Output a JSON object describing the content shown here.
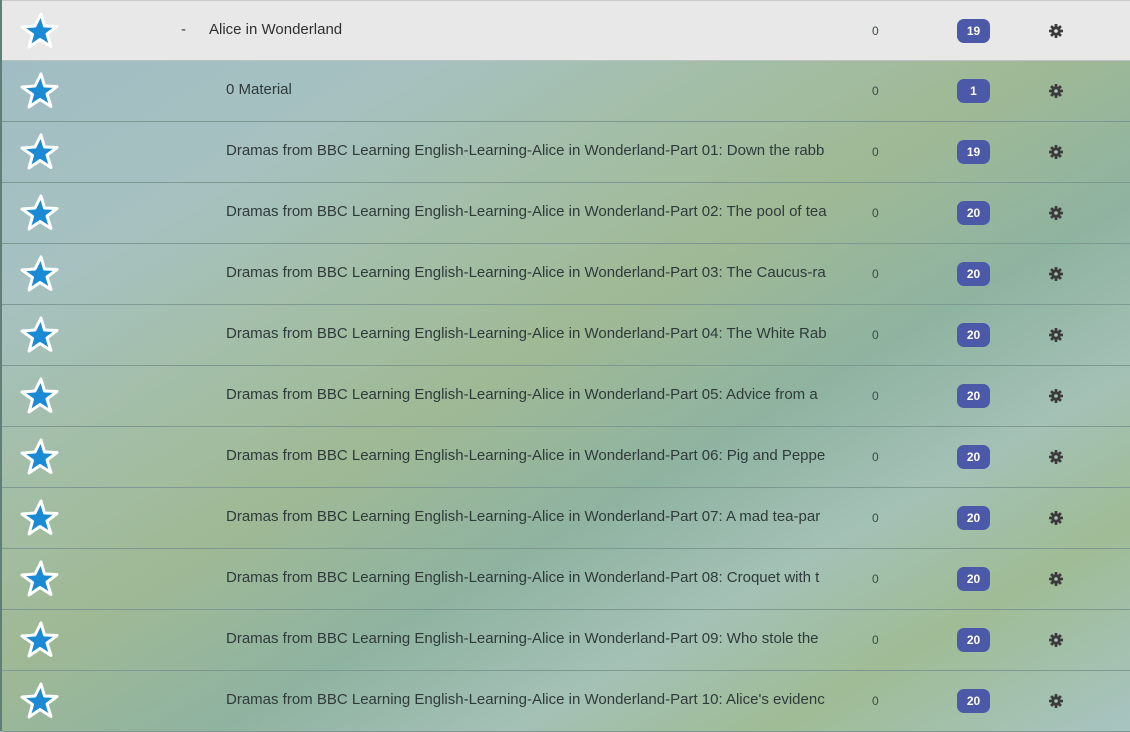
{
  "header": {
    "toggle": "-",
    "title": "Alice in Wonderland",
    "count": "0",
    "badge": "19",
    "star_icon": "star-icon",
    "settings_icon": "gear-icon"
  },
  "rows": [
    {
      "title": "0 Material",
      "count": "0",
      "badge": "1"
    },
    {
      "title": "Dramas from BBC Learning English-Learning-Alice in Wonderland-Part 01: Down the rabb",
      "count": "0",
      "badge": "19"
    },
    {
      "title": "Dramas from BBC Learning English-Learning-Alice in Wonderland-Part 02: The pool of tea",
      "count": "0",
      "badge": "20"
    },
    {
      "title": "Dramas from BBC Learning English-Learning-Alice in Wonderland-Part 03: The Caucus-ra",
      "count": "0",
      "badge": "20"
    },
    {
      "title": "Dramas from BBC Learning English-Learning-Alice in Wonderland-Part 04: The White Rab",
      "count": "0",
      "badge": "20"
    },
    {
      "title": "Dramas from BBC Learning English-Learning-Alice in Wonderland-Part 05: Advice from a",
      "count": "0",
      "badge": "20"
    },
    {
      "title": "Dramas from BBC Learning English-Learning-Alice in Wonderland-Part 06: Pig and Peppe",
      "count": "0",
      "badge": "20"
    },
    {
      "title": "Dramas from BBC Learning English-Learning-Alice in Wonderland-Part 07: A mad tea-par",
      "count": "0",
      "badge": "20"
    },
    {
      "title": "Dramas from BBC Learning English-Learning-Alice in Wonderland-Part 08: Croquet with t",
      "count": "0",
      "badge": "20"
    },
    {
      "title": "Dramas from BBC Learning English-Learning-Alice in Wonderland-Part 09: Who stole the",
      "count": "0",
      "badge": "20"
    },
    {
      "title": "Dramas from BBC Learning English-Learning-Alice in Wonderland-Part 10: Alice's evidenc",
      "count": "0",
      "badge": "20"
    }
  ],
  "colors": {
    "star_fill": "#1a8ad4",
    "star_outline": "#ffffff",
    "badge_bg": "#4b59a8",
    "header_bg": "#e8e8e8"
  }
}
